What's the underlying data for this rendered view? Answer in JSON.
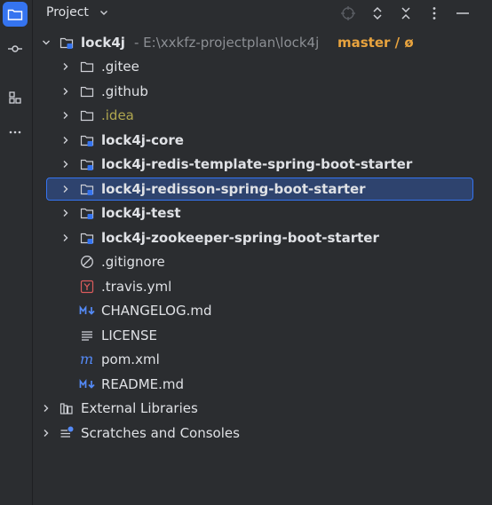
{
  "panel": {
    "title": "Project"
  },
  "root": {
    "name": "lock4j",
    "path": " - E:\\xxkfz-projectplan\\lock4j",
    "branch": "master / ø"
  },
  "folders": [
    {
      "name": ".gitee",
      "style": "normal"
    },
    {
      "name": ".github",
      "style": "normal"
    },
    {
      "name": ".idea",
      "style": "idea"
    }
  ],
  "modules": [
    {
      "name": "lock4j-core"
    },
    {
      "name": "lock4j-redis-template-spring-boot-starter"
    },
    {
      "name": "lock4j-redisson-spring-boot-starter"
    },
    {
      "name": "lock4j-test"
    },
    {
      "name": "lock4j-zookeeper-spring-boot-starter"
    }
  ],
  "files": [
    {
      "name": ".gitignore",
      "icon": "gitignore-icon"
    },
    {
      "name": ".travis.yml",
      "icon": "yaml-icon"
    },
    {
      "name": "CHANGELOG.md",
      "icon": "markdown-icon"
    },
    {
      "name": "LICENSE",
      "icon": "text-file-icon"
    },
    {
      "name": "pom.xml",
      "icon": "maven-icon"
    },
    {
      "name": "README.md",
      "icon": "markdown-icon"
    }
  ],
  "bottom": [
    {
      "name": "External Libraries",
      "icon": "library-icon"
    },
    {
      "name": "Scratches and Consoles",
      "icon": "scratches-icon"
    }
  ],
  "colors": {
    "accent": "#3574f0",
    "selection": "#2e436e",
    "branch": "#e8a33e",
    "idea": "#b0a74f"
  }
}
